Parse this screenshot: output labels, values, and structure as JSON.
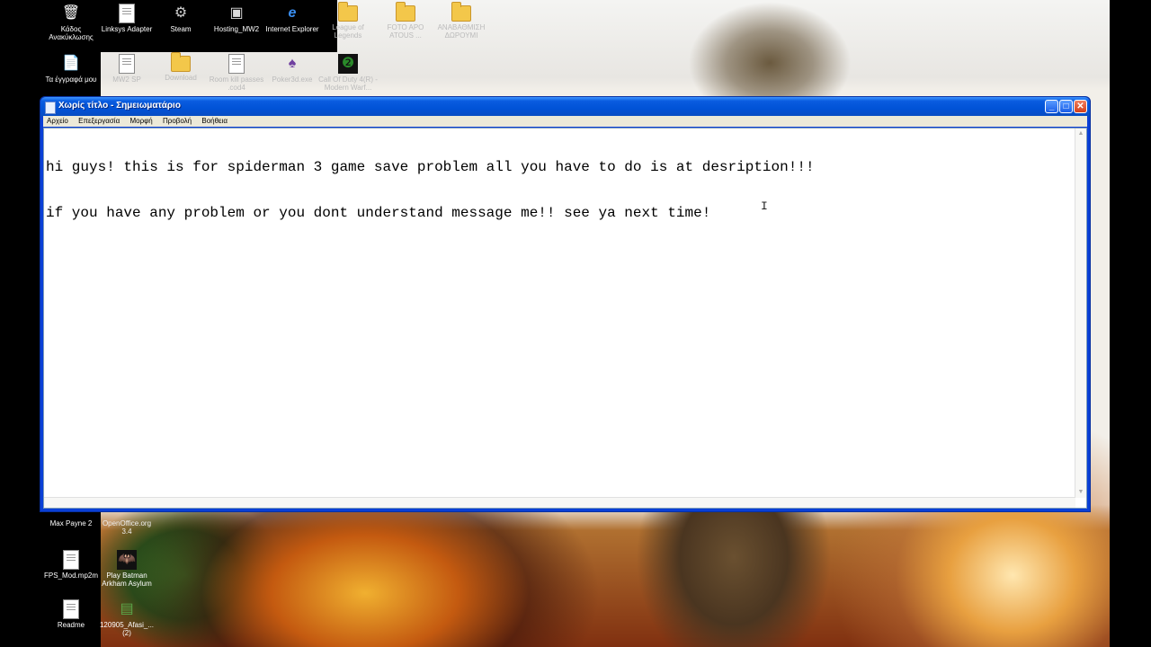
{
  "desktop": {
    "top_icons": [
      {
        "label": "Κάδος Ανακύκλωσης",
        "icon": "recycle-bin-icon",
        "glyph": "🗑"
      },
      {
        "label": "Linksys Adapter",
        "icon": "document-icon",
        "glyph": ""
      },
      {
        "label": "Steam",
        "icon": "steam-icon",
        "glyph": "⚙"
      },
      {
        "label": "Hosting_MW2",
        "icon": "window-app-icon",
        "glyph": "▣"
      },
      {
        "label": "Internet Explorer",
        "icon": "internet-explorer-icon",
        "glyph": "e"
      },
      {
        "label": "League of Legends",
        "icon": "folder-icon",
        "glyph": ""
      },
      {
        "label": "FOTO APO ATOUS ...",
        "icon": "folder-icon",
        "glyph": ""
      },
      {
        "label": "ΑΝΑΒΑΘΜΙΣΗ ΔΩΡΟΥΜΙ",
        "icon": "folder-icon",
        "glyph": ""
      }
    ],
    "second_row_icons": [
      {
        "label": "Τα έγγραφά μου",
        "icon": "my-documents-icon",
        "glyph": "📄"
      },
      {
        "label": "MW2 SP",
        "icon": "document-icon",
        "glyph": ""
      },
      {
        "label": "Download",
        "icon": "folder-icon",
        "glyph": ""
      },
      {
        "label": "Room kill passes .cod4",
        "icon": "document-icon",
        "glyph": ""
      },
      {
        "label": "Poker3d.exe",
        "icon": "poker-icon",
        "glyph": "♠"
      },
      {
        "label": "Call Of Duty 4(R) - Modern Warf...",
        "icon": "call-of-duty-icon",
        "glyph": "❷"
      }
    ],
    "bottom_icons": [
      {
        "label": "Max Payne 2",
        "icon": "max-payne-icon",
        "glyph": ""
      },
      {
        "label": "OpenOffice.org 3.4",
        "icon": "openoffice-icon",
        "glyph": ""
      },
      {
        "label": "FPS_Mod.mp2m",
        "icon": "document-icon",
        "glyph": ""
      },
      {
        "label": "Play Batman Arkham Asylum",
        "icon": "batman-icon",
        "glyph": "🦇"
      },
      {
        "label": "Readme",
        "icon": "document-icon",
        "glyph": ""
      },
      {
        "label": "120905_Afasi_... (2)",
        "icon": "archive-icon",
        "glyph": "▤"
      }
    ]
  },
  "window": {
    "title": "Χωρίς τίτλο - Σημειωματάριο",
    "minimize_glyph": "_",
    "maximize_glyph": "□",
    "close_glyph": "✕",
    "menu": [
      "Αρχείο",
      "Επεξεργασία",
      "Μορφή",
      "Προβολή",
      "Βοήθεια"
    ],
    "content_lines": [
      "hi guys! this is for spiderman 3 game save problem all you have to do is at desription!!!",
      "if you have any problem or you dont understand message me!! see ya next time!"
    ],
    "cursor_glyph": "I"
  }
}
